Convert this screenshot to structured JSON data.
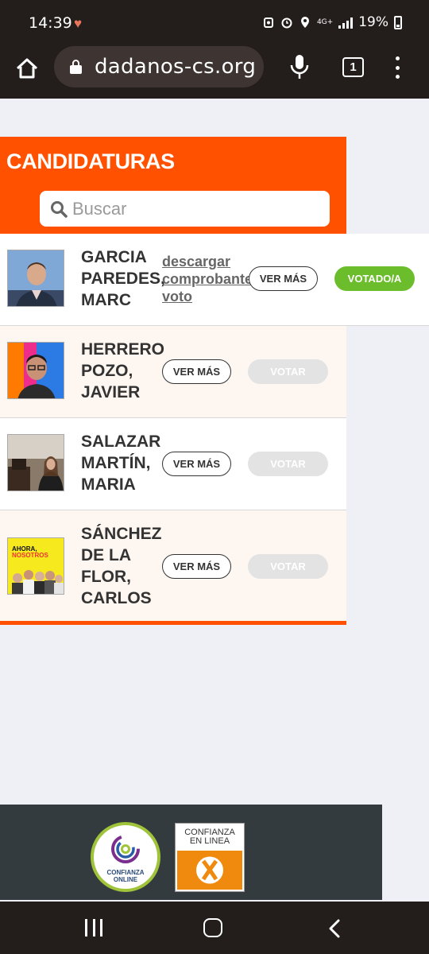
{
  "status_bar": {
    "time": "14:39",
    "network": "4G+",
    "battery": "19%"
  },
  "browser": {
    "url": "dadanos-cs.org",
    "tab_count": "1"
  },
  "page": {
    "title": "CANDIDATURAS",
    "search": {
      "placeholder": "Buscar",
      "value": ""
    }
  },
  "candidates": [
    {
      "name_lines": [
        "GARCIA",
        "PAREDES,",
        "MARC"
      ],
      "download_link_lines": [
        "descargar",
        "comprobante",
        "voto"
      ],
      "more_label": "VER MÁS",
      "vote_label": "VOTADO/A",
      "voted": true
    },
    {
      "name_lines": [
        "HERRERO",
        "POZO,",
        "JAVIER"
      ],
      "more_label": "VER MÁS",
      "vote_label": "VOTAR",
      "voted": false
    },
    {
      "name_lines": [
        "SALAZAR",
        "MARTÍN,",
        "MARIA"
      ],
      "more_label": "VER MÁS",
      "vote_label": "VOTAR",
      "voted": false
    },
    {
      "name_lines": [
        "SÁNCHEZ",
        "DE LA",
        "FLOR,",
        "CARLOS"
      ],
      "photo_text": [
        "AHORA,",
        "NOSOTROS"
      ],
      "more_label": "VER MÁS",
      "vote_label": "VOTAR",
      "voted": false
    }
  ],
  "footer": {
    "seal_text": [
      "CONFIANZA",
      "ONLINE"
    ],
    "trust_text": [
      "CONFIANZA",
      "EN LINEA"
    ]
  },
  "colors": {
    "brand": "#ff5100",
    "voted": "#6cbd2c",
    "vote_disabled": "#e3e3e3"
  },
  "icons": [
    "home-icon",
    "lock-icon",
    "mic-icon",
    "tabs-icon",
    "more-vert-icon",
    "search-icon",
    "recent-apps-icon",
    "nav-home-icon",
    "back-icon"
  ]
}
